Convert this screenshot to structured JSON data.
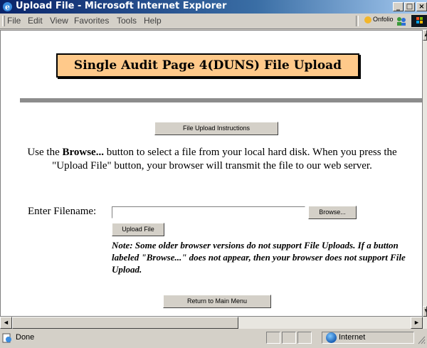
{
  "window": {
    "title": "Upload File - Microsoft Internet Explorer",
    "minimize_icon": "minimize-icon",
    "maximize_icon": "maximize-icon",
    "close_icon": "close-icon"
  },
  "menu": {
    "items": [
      "File",
      "Edit",
      "View",
      "Favorites",
      "Tools",
      "Help"
    ],
    "onfolio_label": "Onfolio"
  },
  "page": {
    "heading": "Single Audit Page 4(DUNS) File Upload",
    "instructions_button": "File Upload Instructions",
    "intro_part1": "Use the ",
    "intro_bold": "Browse...",
    "intro_part2": " button to select a file from your local hard disk. When you press the \"Upload File\" button, your browser will transmit the file to our web server.",
    "filename_label": "Enter Filename:",
    "filename_value": "",
    "browse_button": "Browse...",
    "upload_button": "Upload File",
    "note": "Note: Some older browser versions do not support File Uploads. If a button labeled \"Browse...\" does not appear, then your browser does not support File Upload.",
    "return_button": "Return to Main Menu"
  },
  "statusbar": {
    "status_text": "Done",
    "zone_text": "Internet"
  },
  "colors": {
    "heading_bg": "#ffc98a",
    "titlebar": "#0a246a",
    "divider": "#8c8c8c"
  }
}
